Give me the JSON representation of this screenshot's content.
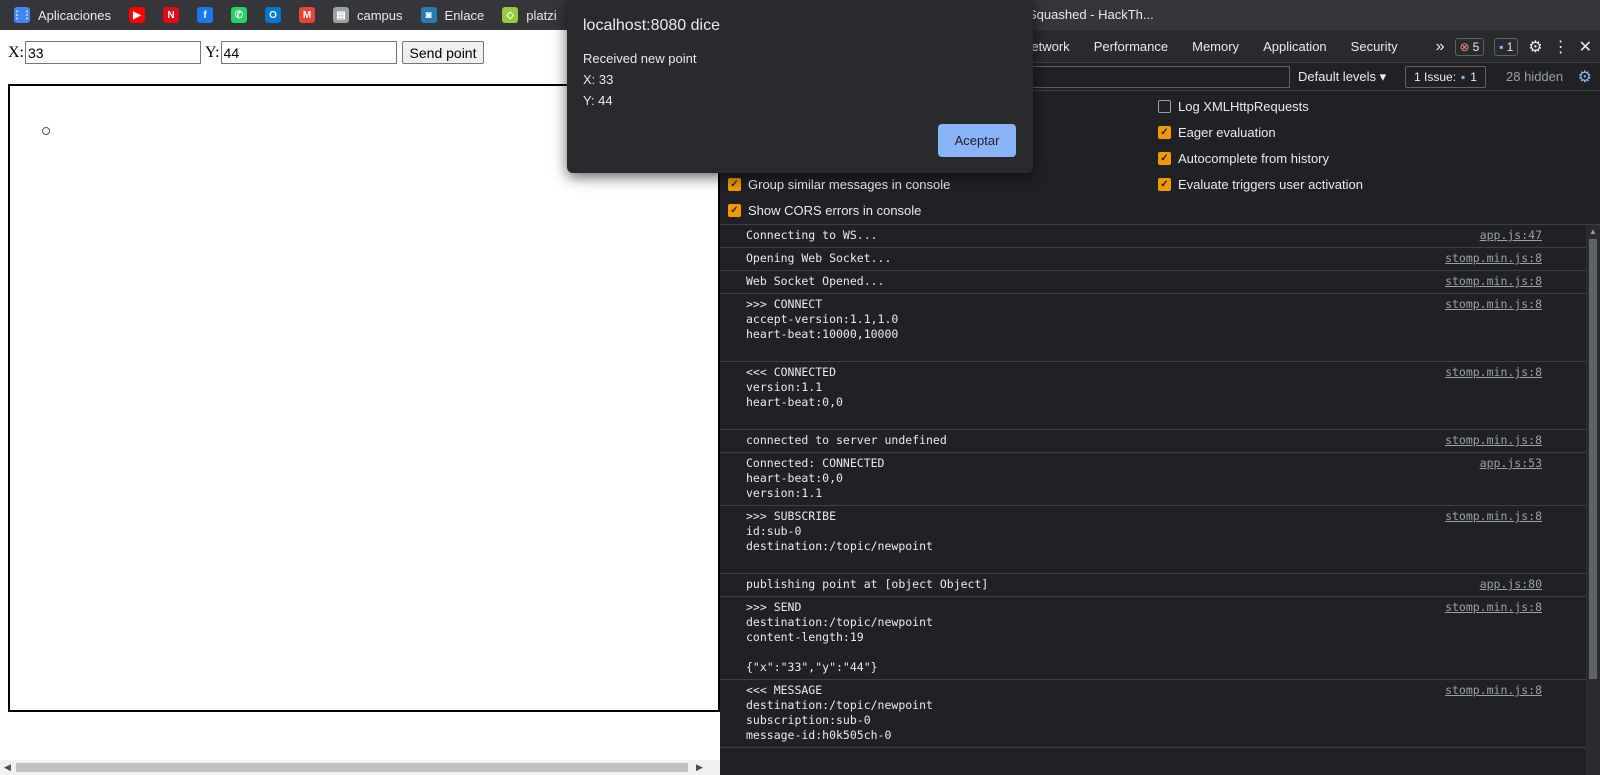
{
  "bookmarks": [
    {
      "label": "Aplicaciones",
      "icon": "apps-grid-icon",
      "glyph": "⋮⋮",
      "color": "#4285f4"
    },
    {
      "label": "",
      "icon": "youtube-icon",
      "glyph": "▶",
      "color": "#ff0000"
    },
    {
      "label": "",
      "icon": "netflix-icon",
      "glyph": "N",
      "color": "#e50914"
    },
    {
      "label": "",
      "icon": "facebook-icon",
      "glyph": "f",
      "color": "#1877f2"
    },
    {
      "label": "",
      "icon": "whatsapp-icon",
      "glyph": "✆",
      "color": "#25d366"
    },
    {
      "label": "",
      "icon": "outlook-icon",
      "glyph": "O",
      "color": "#0078d4"
    },
    {
      "label": "",
      "icon": "gmail-icon",
      "glyph": "M",
      "color": "#ea4335"
    },
    {
      "label": "campus",
      "icon": "campus-icon",
      "glyph": "▤",
      "color": "#9aa0a6"
    },
    {
      "label": "Enlace",
      "icon": "enlace-icon",
      "glyph": "◙",
      "color": "#2a7ab0"
    },
    {
      "label": "platzi",
      "icon": "platzi-icon",
      "glyph": "◇",
      "color": "#98ca3f"
    }
  ],
  "tab_title": "Squashed - HackTh...",
  "form": {
    "x_label": "X:",
    "x_value": "33",
    "y_label": "Y:",
    "y_value": "44",
    "send_label": "Send point"
  },
  "dialog": {
    "title": "localhost:8080 dice",
    "line1": "Received new point",
    "line2": "X: 33",
    "line3": "Y: 44",
    "ok_label": "Aceptar"
  },
  "devtools": {
    "tabs": [
      "Network",
      "Performance",
      "Memory",
      "Application",
      "Security"
    ],
    "more": "»",
    "errors_count": "5",
    "messages_count": "1",
    "levels_label": "Default levels ▾",
    "issue_label": "1 Issue:",
    "issue_count": "1",
    "hidden_label": "28 hidden",
    "settings": [
      {
        "label": "Group similar messages in console",
        "checked": true
      },
      {
        "label": "Show CORS errors in console",
        "checked": true
      },
      {
        "label": "Log XMLHttpRequests",
        "checked": false
      },
      {
        "label": "Eager evaluation",
        "checked": true
      },
      {
        "label": "Autocomplete from history",
        "checked": true
      },
      {
        "label": "Evaluate triggers user activation",
        "checked": true
      }
    ],
    "messages": [
      {
        "text": "Connecting to WS...",
        "src": "app.js:47"
      },
      {
        "text": "Opening Web Socket...",
        "src": "stomp.min.js:8"
      },
      {
        "text": "Web Socket Opened...",
        "src": "stomp.min.js:8"
      },
      {
        "text": ">>> CONNECT\naccept-version:1.1,1.0\nheart-beat:10000,10000\n\n",
        "src": "stomp.min.js:8"
      },
      {
        "text": "<<< CONNECTED\nversion:1.1\nheart-beat:0,0\n\n",
        "src": "stomp.min.js:8"
      },
      {
        "text": "connected to server undefined",
        "src": "stomp.min.js:8"
      },
      {
        "text": "Connected: CONNECTED\nheart-beat:0,0\nversion:1.1\n",
        "src": "app.js:53"
      },
      {
        "text": ">>> SUBSCRIBE\nid:sub-0\ndestination:/topic/newpoint\n\n",
        "src": "stomp.min.js:8"
      },
      {
        "text": "publishing point at [object Object]",
        "src": "app.js:80"
      },
      {
        "text": ">>> SEND\ndestination:/topic/newpoint\ncontent-length:19\n\n{\"x\":\"33\",\"y\":\"44\"}",
        "src": "stomp.min.js:8"
      },
      {
        "text": "<<< MESSAGE\ndestination:/topic/newpoint\nsubscription:sub-0\nmessage-id:h0k505ch-0",
        "src": "stomp.min.js:8"
      }
    ]
  }
}
